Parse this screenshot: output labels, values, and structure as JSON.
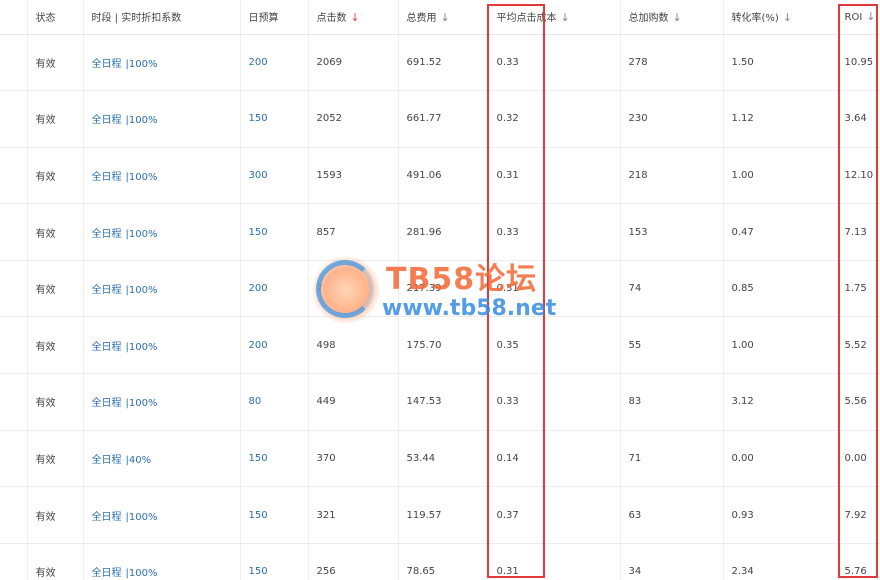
{
  "columns": {
    "status": "状态",
    "period": "时段 | 实时折扣系数",
    "budget": "日预算",
    "clicks": "点击数",
    "cost": "总费用",
    "cpc": "平均点击成本",
    "carts": "总加购数",
    "conv": "转化率(%)",
    "roi": "ROI"
  },
  "sort_arrow": "↓",
  "link_separator": "|",
  "watermark": {
    "title": "TB58论坛",
    "url": "www.tb58.net"
  },
  "rows": [
    {
      "status": "有效",
      "period": "全日程",
      "discount": "100%",
      "budget": "200",
      "clicks": "2069",
      "cost": "691.52",
      "cpc": "0.33",
      "carts": "278",
      "conv": "1.50",
      "roi": "10.95"
    },
    {
      "status": "有效",
      "period": "全日程",
      "discount": "100%",
      "budget": "150",
      "clicks": "2052",
      "cost": "661.77",
      "cpc": "0.32",
      "carts": "230",
      "conv": "1.12",
      "roi": "3.64"
    },
    {
      "status": "有效",
      "period": "全日程",
      "discount": "100%",
      "budget": "300",
      "clicks": "1593",
      "cost": "491.06",
      "cpc": "0.31",
      "carts": "218",
      "conv": "1.00",
      "roi": "12.10"
    },
    {
      "status": "有效",
      "period": "全日程",
      "discount": "100%",
      "budget": "150",
      "clicks": "857",
      "cost": "281.96",
      "cpc": "0.33",
      "carts": "153",
      "conv": "0.47",
      "roi": "7.13"
    },
    {
      "status": "有效",
      "period": "全日程",
      "discount": "100%",
      "budget": "200",
      "clicks": "705",
      "cost": "217.39",
      "cpc": "0.31",
      "carts": "74",
      "conv": "0.85",
      "roi": "1.75"
    },
    {
      "status": "有效",
      "period": "全日程",
      "discount": "100%",
      "budget": "200",
      "clicks": "498",
      "cost": "175.70",
      "cpc": "0.35",
      "carts": "55",
      "conv": "1.00",
      "roi": "5.52"
    },
    {
      "status": "有效",
      "period": "全日程",
      "discount": "100%",
      "budget": "80",
      "clicks": "449",
      "cost": "147.53",
      "cpc": "0.33",
      "carts": "83",
      "conv": "3.12",
      "roi": "5.56"
    },
    {
      "status": "有效",
      "period": "全日程",
      "discount": "40%",
      "budget": "150",
      "clicks": "370",
      "cost": "53.44",
      "cpc": "0.14",
      "carts": "71",
      "conv": "0.00",
      "roi": "0.00"
    },
    {
      "status": "有效",
      "period": "全日程",
      "discount": "100%",
      "budget": "150",
      "clicks": "321",
      "cost": "119.57",
      "cpc": "0.37",
      "carts": "63",
      "conv": "0.93",
      "roi": "7.92"
    },
    {
      "status": "有效",
      "period": "全日程",
      "discount": "100%",
      "budget": "150",
      "clicks": "256",
      "cost": "78.65",
      "cpc": "0.31",
      "carts": "34",
      "conv": "2.34",
      "roi": "5.76"
    }
  ]
}
